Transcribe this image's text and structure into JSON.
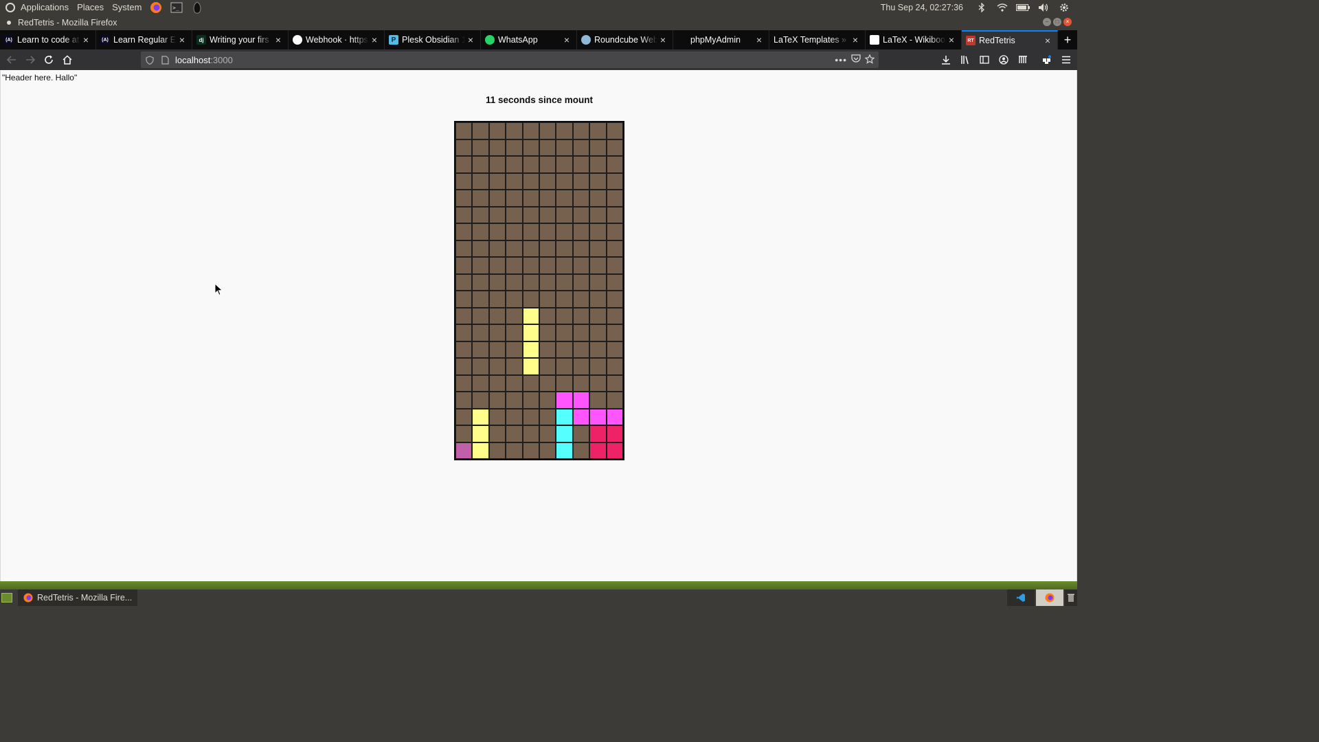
{
  "top_panel": {
    "menus": [
      "Applications",
      "Places",
      "System"
    ],
    "clock": "Thu Sep 24, 02:27:36"
  },
  "window": {
    "title": "RedTetris - Mozilla Firefox"
  },
  "tabs": [
    {
      "label": "Learn to code at",
      "icon": "freecodecamp-icon",
      "favicon_text": "(A)",
      "active": false
    },
    {
      "label": "Learn Regular Ex",
      "icon": "freecodecamp-icon",
      "favicon_text": "(A)",
      "active": false
    },
    {
      "label": "Writing your firs",
      "icon": "django-icon",
      "favicon_text": "dj",
      "active": false
    },
    {
      "label": "Webhook · https",
      "icon": "github-icon",
      "favicon_text": "",
      "active": false
    },
    {
      "label": "Plesk Obsidian 1",
      "icon": "plesk-icon",
      "favicon_text": "P",
      "active": false
    },
    {
      "label": "WhatsApp",
      "icon": "whatsapp-icon",
      "favicon_text": "",
      "active": false
    },
    {
      "label": "Roundcube Web",
      "icon": "roundcube-icon",
      "favicon_text": "",
      "active": false
    },
    {
      "label": "phpMyAdmin",
      "icon": "warning-icon",
      "favicon_text": "",
      "active": false
    },
    {
      "label": "LaTeX Templates »",
      "icon": "none",
      "favicon_text": "",
      "active": false
    },
    {
      "label": "LaTeX - Wikiboo",
      "icon": "wikibooks-icon",
      "favicon_text": "",
      "active": false
    },
    {
      "label": "RedTetris",
      "icon": "redtetris-icon",
      "favicon_text": "RT",
      "active": true
    }
  ],
  "urlbar": {
    "host": "localhost",
    "port": ":3000"
  },
  "page": {
    "header_text": "\"Header here. Hallo\"",
    "timer_text": "11 seconds since mount"
  },
  "board": {
    "cols": 10,
    "rows": 20,
    "empty_color": "#76604e",
    "palette": {
      "Y": "#fffe8a",
      "M": "#ff55ff",
      "C": "#55ffff",
      "R": "#ee2266",
      "P": "#c060a8"
    },
    "cells": [
      "..........",
      "..........",
      "..........",
      "..........",
      "..........",
      "..........",
      "..........",
      "..........",
      "..........",
      "..........",
      "..........",
      "....Y.....",
      "....Y.....",
      "....Y.....",
      "....Y.....",
      "..........",
      "......MM..",
      ".Y....CMMM",
      ".Y....C.RR",
      "PY....C.RR"
    ]
  },
  "taskbar": {
    "firefox_task": "RedTetris - Mozilla Fire..."
  }
}
